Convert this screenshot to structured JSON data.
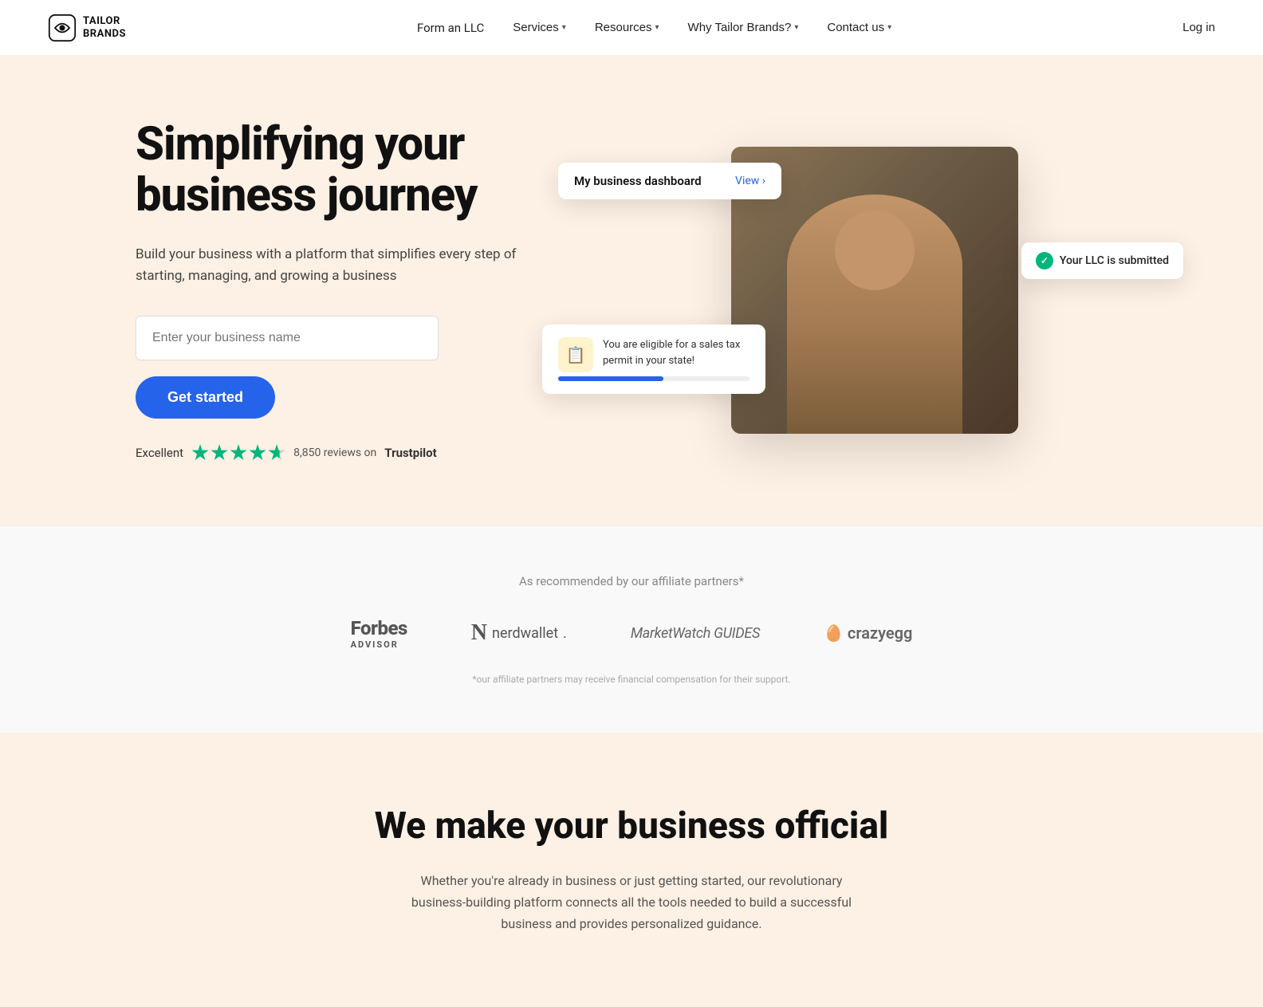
{
  "navbar": {
    "logo_text": "TAILOR\nBRANDS",
    "logo_alt": "Tailor Brands",
    "links": [
      {
        "label": "Form an LLC",
        "has_dropdown": false
      },
      {
        "label": "Services",
        "has_dropdown": true
      },
      {
        "label": "Resources",
        "has_dropdown": true
      },
      {
        "label": "Why Tailor Brands?",
        "has_dropdown": true
      },
      {
        "label": "Contact us",
        "has_dropdown": true
      }
    ],
    "login_label": "Log in"
  },
  "hero": {
    "title_line1": "Simplifying your",
    "title_line2": "business journey",
    "subtitle": "Build your business with a platform that simplifies every step of starting, managing, and growing a business",
    "input_placeholder": "Enter your business name",
    "cta_label": "Get started",
    "trustpilot": {
      "prefix": "Excellent",
      "reviews_text": "8,850 reviews on",
      "brand": "Trustpilot"
    },
    "dashboard_card": {
      "title": "My business dashboard",
      "view_label": "View ›"
    },
    "llc_badge": {
      "text": "Your LLC is submitted"
    },
    "sales_tax_card": {
      "text": "You are eligible for a sales tax permit in your state!"
    }
  },
  "partners": {
    "label": "As recommended by our affiliate partners*",
    "logos": [
      {
        "name": "Forbes Advisor",
        "display": "Forbes\nADVISOR"
      },
      {
        "name": "NerdWallet",
        "display": "nerdwallet."
      },
      {
        "name": "MarketWatch Guides",
        "display": "MarketWatch GUIDES"
      },
      {
        "name": "CrazyEgg",
        "display": "crazyegg"
      }
    ],
    "disclaimer": "*our affiliate partners may receive financial compensation for their support."
  },
  "bottom": {
    "title": "We make your business official",
    "text": "Whether you're already in business or just getting started, our revolutionary business-building platform connects all the tools needed to build a successful business and provides personalized guidance."
  }
}
